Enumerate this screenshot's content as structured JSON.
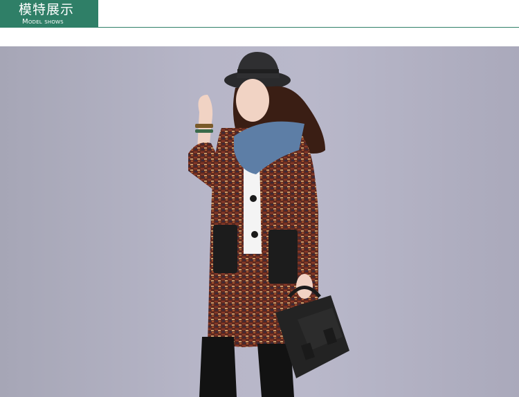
{
  "header": {
    "title": "模特展示",
    "subtitle": "Model shows",
    "accent_color": "#2f7f67"
  },
  "photo": {
    "subject": "model-wearing-knit-cardigan"
  }
}
